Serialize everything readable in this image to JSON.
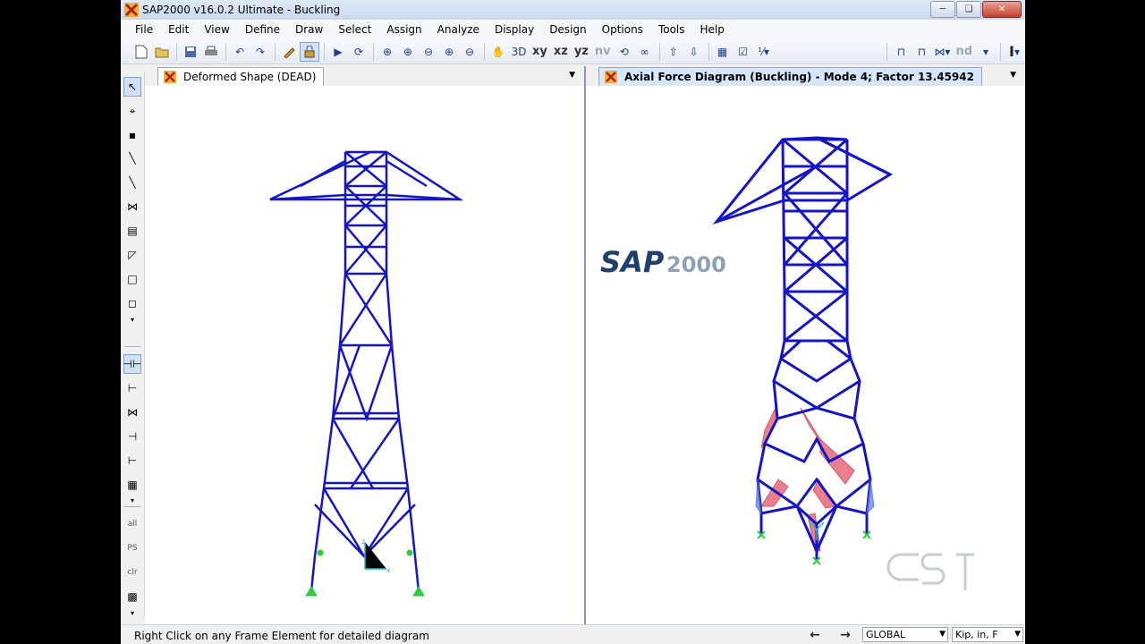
{
  "window": {
    "title": "SAP2000 v16.0.2 Ultimate  - Buckling",
    "minimize": "─",
    "maximize": "❏",
    "close": "✕"
  },
  "menu": [
    "File",
    "Edit",
    "View",
    "Define",
    "Draw",
    "Select",
    "Assign",
    "Analyze",
    "Display",
    "Design",
    "Options",
    "Tools",
    "Help"
  ],
  "toolbar": {
    "view_labels": [
      "xy",
      "xz",
      "yz",
      "nv"
    ],
    "nd_label": "nd"
  },
  "panels": {
    "left": {
      "tab_title": "Deformed Shape (DEAD)",
      "dropdown": "▼"
    },
    "right": {
      "tab_title": "Axial Force Diagram   (Buckling) - Mode 4; Factor 13.45942",
      "dropdown": "▼"
    }
  },
  "axes": {
    "z": "z",
    "x": "x"
  },
  "watermark": {
    "logo": "SAP2000"
  },
  "status": {
    "message": "Right Click on any Frame Element for detailed diagram",
    "coord_system": "GLOBAL",
    "units": "Kip, in, F",
    "prev": "←",
    "next": "→",
    "dropdown_arrow": "▼"
  },
  "colors": {
    "frame": "#1414c8",
    "support": "#2ecc40",
    "axis": "#18c0d8",
    "compression": "#e86a78",
    "tension": "#4a6ad8"
  }
}
